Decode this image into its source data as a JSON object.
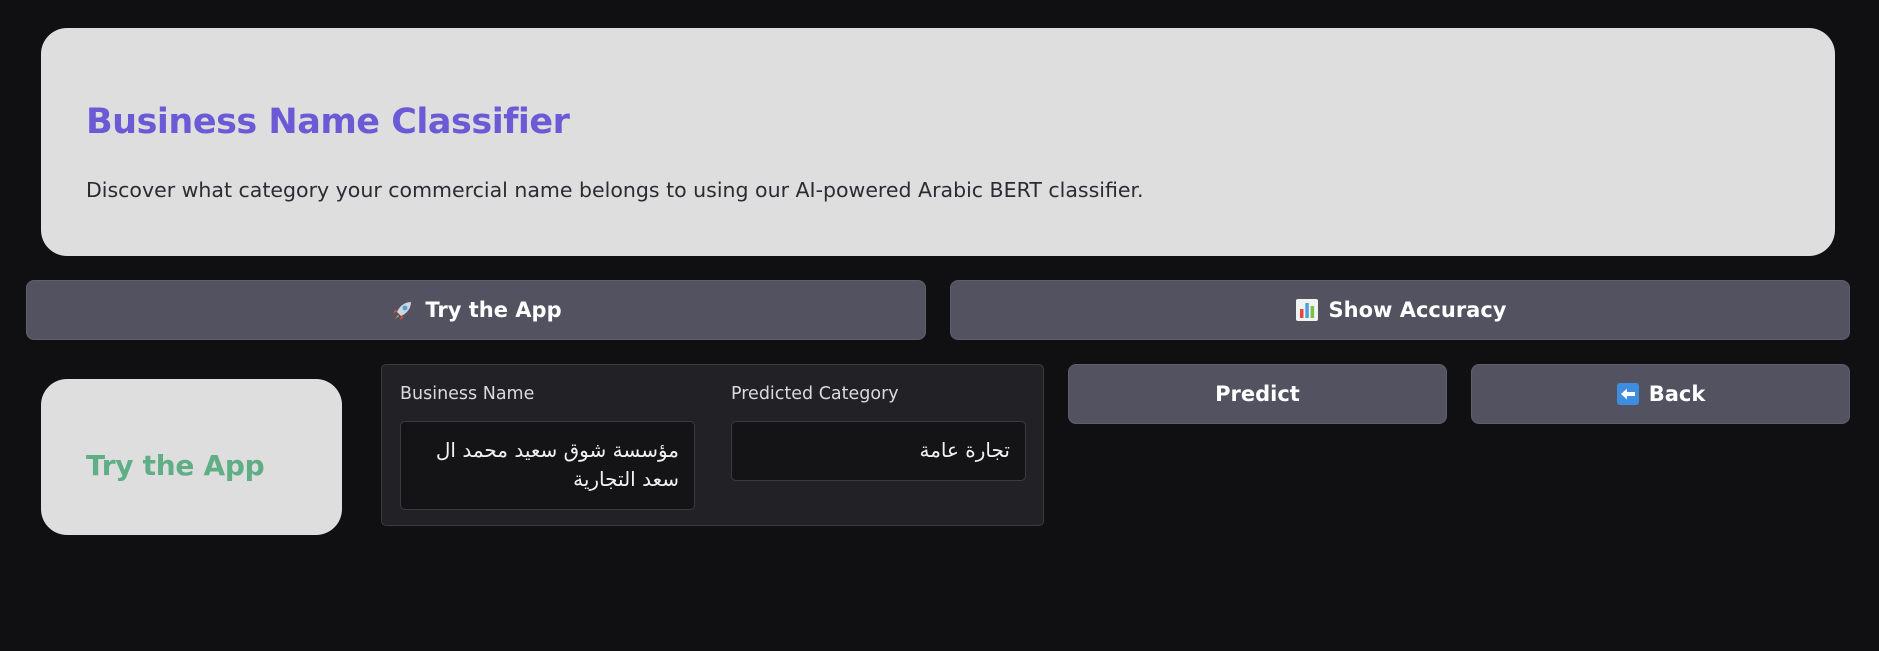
{
  "hero": {
    "title": "Business Name Classifier",
    "description": "Discover what category your commercial name belongs to using our AI-powered Arabic BERT classifier."
  },
  "nav": {
    "try_app": {
      "icon": "rocket-icon",
      "label": "Try the App"
    },
    "show_accuracy": {
      "icon": "bar-chart-icon",
      "label": "Show Accuracy"
    }
  },
  "section": {
    "title": "Try the App"
  },
  "form": {
    "business_name_label": "Business Name",
    "business_name_value": "مؤسسة شوق سعيد محمد ال سعد التجارية",
    "predicted_category_label": "Predicted Category",
    "predicted_category_value": "تجارة عامة"
  },
  "actions": {
    "predict_label": "Predict",
    "back": {
      "icon": "left-arrow-icon",
      "label": "Back"
    }
  },
  "colors": {
    "background": "#101013",
    "card": "#dedede",
    "title_accent": "#6a5ad6",
    "section_accent": "#5fae86",
    "button": "#525260"
  }
}
